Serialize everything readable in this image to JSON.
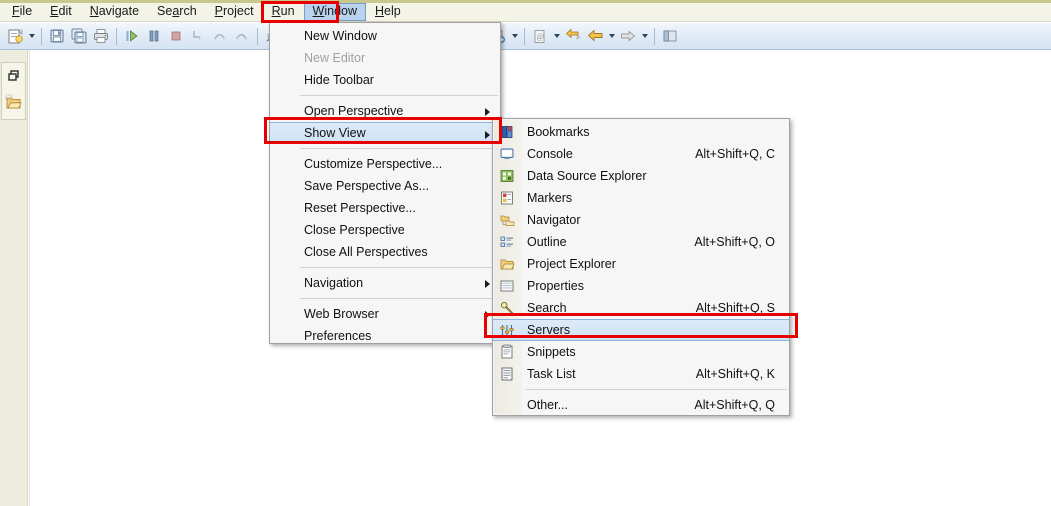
{
  "menubar": {
    "items": [
      {
        "label": "File",
        "mnemonic": "F"
      },
      {
        "label": "Edit",
        "mnemonic": "E"
      },
      {
        "label": "Navigate",
        "mnemonic": "N"
      },
      {
        "label": "Search",
        "mnemonic": "a"
      },
      {
        "label": "Project",
        "mnemonic": "P"
      },
      {
        "label": "Run",
        "mnemonic": "R"
      },
      {
        "label": "Window",
        "mnemonic": "W",
        "active": true
      },
      {
        "label": "Help",
        "mnemonic": "H"
      }
    ]
  },
  "toolbar": {
    "groups": [
      {
        "buttons": [
          {
            "icon": "new-wizard-icon",
            "dropdown": true
          }
        ]
      },
      {
        "buttons": [
          {
            "icon": "save-icon"
          },
          {
            "icon": "save-all-icon"
          },
          {
            "icon": "print-icon"
          }
        ]
      },
      {
        "buttons": [
          {
            "icon": "resume-icon"
          },
          {
            "icon": "suspend-icon"
          },
          {
            "icon": "terminate-icon"
          },
          {
            "icon": "step-into-icon"
          },
          {
            "icon": "step-over-icon"
          },
          {
            "icon": "step-return-icon"
          }
        ]
      },
      {
        "buttons": [
          {
            "icon": "disconnect-icon"
          }
        ]
      },
      {
        "buttons": [
          {
            "icon": "debug-icon",
            "dropdown": true
          },
          {
            "icon": "run-icon",
            "dropdown": true
          },
          {
            "icon": "run-coverage-icon",
            "dropdown": true
          }
        ]
      },
      {
        "buttons": [
          {
            "icon": "open-type-icon"
          },
          {
            "icon": "open-resource-icon"
          },
          {
            "icon": "new-java-project-icon",
            "dropdown": true
          }
        ]
      },
      {
        "buttons": [
          {
            "icon": "new-class-icon",
            "dropdown": true
          }
        ]
      },
      {
        "buttons": [
          {
            "icon": "new-annotation-icon",
            "dropdown": true
          },
          {
            "icon": "last-edit-location-icon"
          },
          {
            "icon": "back-icon",
            "dropdown": true
          },
          {
            "icon": "forward-icon",
            "dropdown": true
          }
        ]
      },
      {
        "buttons": [
          {
            "icon": "open-perspective-icon"
          }
        ]
      }
    ]
  },
  "left_rail": {
    "fast_view_items": [
      {
        "icon": "restore-icon",
        "name": "restore-fast-view-icon"
      },
      {
        "icon": "project-explorer-icon",
        "name": "fast-view-project-explorer-icon"
      }
    ]
  },
  "window_menu": {
    "items": [
      {
        "label": "New Window",
        "type": "item"
      },
      {
        "label": "New Editor",
        "type": "item",
        "disabled": true
      },
      {
        "label": "Hide Toolbar",
        "type": "item"
      },
      {
        "type": "separator"
      },
      {
        "label": "Open Perspective",
        "type": "item",
        "submenu": true
      },
      {
        "label": "Show View",
        "type": "item",
        "submenu": true,
        "selected": true
      },
      {
        "type": "separator"
      },
      {
        "label": "Customize Perspective...",
        "type": "item"
      },
      {
        "label": "Save Perspective As...",
        "type": "item"
      },
      {
        "label": "Reset Perspective...",
        "type": "item"
      },
      {
        "label": "Close Perspective",
        "type": "item"
      },
      {
        "label": "Close All Perspectives",
        "type": "item"
      },
      {
        "type": "separator"
      },
      {
        "label": "Navigation",
        "type": "item",
        "submenu": true
      },
      {
        "type": "separator"
      },
      {
        "label": "Web Browser",
        "type": "item",
        "submenu": true
      },
      {
        "label": "Preferences",
        "type": "item"
      }
    ]
  },
  "show_view_menu": {
    "items": [
      {
        "label": "Bookmarks",
        "icon": "bookmarks-icon",
        "accel": ""
      },
      {
        "label": "Console",
        "icon": "console-icon",
        "accel": "Alt+Shift+Q, C"
      },
      {
        "label": "Data Source Explorer",
        "icon": "data-source-explorer-icon",
        "accel": ""
      },
      {
        "label": "Markers",
        "icon": "markers-icon",
        "accel": ""
      },
      {
        "label": "Navigator",
        "icon": "navigator-icon",
        "accel": ""
      },
      {
        "label": "Outline",
        "icon": "outline-icon",
        "accel": "Alt+Shift+Q, O"
      },
      {
        "label": "Project Explorer",
        "icon": "project-explorer-icon",
        "accel": ""
      },
      {
        "label": "Properties",
        "icon": "properties-icon",
        "accel": ""
      },
      {
        "label": "Search",
        "icon": "search-icon",
        "accel": "Alt+Shift+Q, S"
      },
      {
        "label": "Servers",
        "icon": "servers-icon",
        "accel": "",
        "selected": true
      },
      {
        "label": "Snippets",
        "icon": "snippets-icon",
        "accel": ""
      },
      {
        "label": "Task List",
        "icon": "task-list-icon",
        "accel": "Alt+Shift+Q, K"
      },
      {
        "type": "separator"
      },
      {
        "label": "Other...",
        "icon": "",
        "accel": "Alt+Shift+Q, Q"
      }
    ]
  },
  "annotations": {
    "boxes": [
      {
        "name": "window-menu-highlight",
        "target": "Window"
      },
      {
        "name": "show-view-highlight",
        "target": "Show View"
      },
      {
        "name": "servers-highlight",
        "target": "Servers"
      }
    ],
    "color": "#e60000"
  }
}
